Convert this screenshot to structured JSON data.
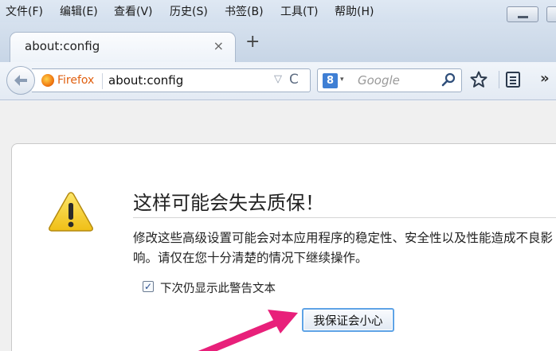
{
  "menu": [
    "文件(F)",
    "编辑(E)",
    "查看(V)",
    "历史(S)",
    "书签(B)",
    "工具(T)",
    "帮助(H)"
  ],
  "tab": {
    "title": "about:config",
    "close": "×",
    "new_tab": "+"
  },
  "urlbar": {
    "identity": "Firefox",
    "url": "about:config",
    "dropdown": "▽",
    "reload": "C"
  },
  "search": {
    "engine_letter": "8",
    "caret": "▾",
    "placeholder": "Google"
  },
  "toolbar": {
    "overflow": "»"
  },
  "warning": {
    "title": "这样可能会失去质保！",
    "description": "修改这些高级设置可能会对本应用程序的稳定性、安全性以及性能造成不良影响。请仅在您十分清楚的情况下继续操作。",
    "checkbox_label": "下次仍显示此警告文本",
    "checkbox_checked": true,
    "checkbox_mark": "✓",
    "button_label": "我保证会小心"
  },
  "colors": {
    "arrow": "#e8207a",
    "firefox_label": "#e06010",
    "warning_yellow": "#f7d23a",
    "focus_border": "#5ea3e6"
  }
}
